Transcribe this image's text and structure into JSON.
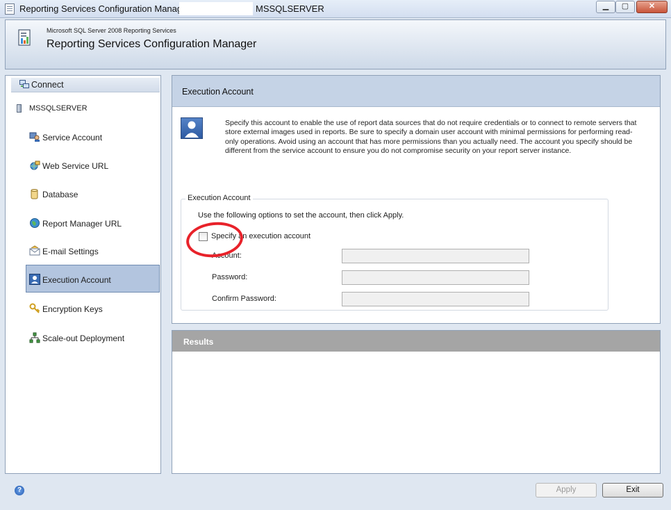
{
  "window": {
    "title": "Reporting Services Configuration Manager:",
    "server": "MSSQLSERVER",
    "controls": {
      "minimize": "▁",
      "maximize": "▢",
      "close": "✕"
    }
  },
  "banner": {
    "subtitle": "Microsoft SQL Server 2008 Reporting Services",
    "title": "Reporting Services Configuration Manager"
  },
  "sidebar": {
    "connect_label": "Connect",
    "server_name": "MSSQLSERVER",
    "items": [
      {
        "label": "Service Account",
        "icon": "service-account-icon"
      },
      {
        "label": "Web Service URL",
        "icon": "web-service-icon"
      },
      {
        "label": "Database",
        "icon": "database-icon"
      },
      {
        "label": "Report Manager URL",
        "icon": "globe-icon"
      },
      {
        "label": "E-mail Settings",
        "icon": "email-icon"
      },
      {
        "label": "Execution Account",
        "icon": "user-icon",
        "selected": true
      },
      {
        "label": "Encryption Keys",
        "icon": "keys-icon"
      },
      {
        "label": "Scale-out Deployment",
        "icon": "network-icon"
      }
    ]
  },
  "main": {
    "header": "Execution Account",
    "description": "Specify this account to enable the use of report data sources that do not require credentials or to connect to remote servers that store external images used in reports. Be sure to specify a domain user account with minimal permissions for performing read-only operations. Avoid using an account that has more permissions than you actually need. The account you specify should be different from the service account to ensure you do not compromise security on your report server instance.",
    "group_title": "Execution Account",
    "instructions": "Use the following options to set the account, then click Apply.",
    "checkbox_label": "Specify an execution account",
    "checkbox_checked": false,
    "fields": {
      "account_label": "Account:",
      "account_value": "",
      "password_label": "Password:",
      "password_value": "",
      "confirm_label": "Confirm Password:",
      "confirm_value": ""
    }
  },
  "results": {
    "title": "Results"
  },
  "footer": {
    "apply_label": "Apply",
    "exit_label": "Exit",
    "help_glyph": "?"
  },
  "colors": {
    "annotation_circle": "#e8222a",
    "selected_item": "#b3c5df"
  }
}
